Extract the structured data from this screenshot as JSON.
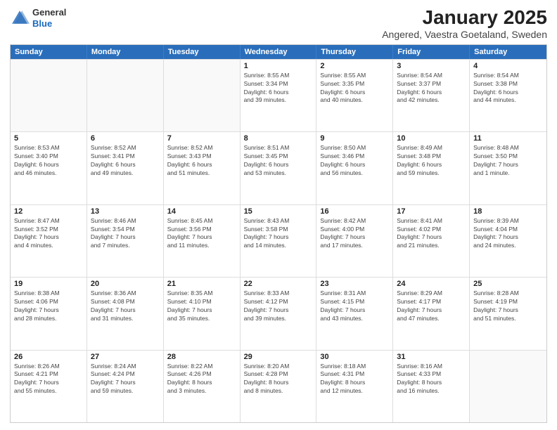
{
  "header": {
    "logo": {
      "general": "General",
      "blue": "Blue"
    },
    "title": "January 2025",
    "subtitle": "Angered, Vaestra Goetaland, Sweden"
  },
  "weekdays": [
    "Sunday",
    "Monday",
    "Tuesday",
    "Wednesday",
    "Thursday",
    "Friday",
    "Saturday"
  ],
  "rows": [
    [
      {
        "day": "",
        "info": "",
        "empty": true
      },
      {
        "day": "",
        "info": "",
        "empty": true
      },
      {
        "day": "",
        "info": "",
        "empty": true
      },
      {
        "day": "1",
        "info": "Sunrise: 8:55 AM\nSunset: 3:34 PM\nDaylight: 6 hours\nand 39 minutes."
      },
      {
        "day": "2",
        "info": "Sunrise: 8:55 AM\nSunset: 3:35 PM\nDaylight: 6 hours\nand 40 minutes."
      },
      {
        "day": "3",
        "info": "Sunrise: 8:54 AM\nSunset: 3:37 PM\nDaylight: 6 hours\nand 42 minutes."
      },
      {
        "day": "4",
        "info": "Sunrise: 8:54 AM\nSunset: 3:38 PM\nDaylight: 6 hours\nand 44 minutes."
      }
    ],
    [
      {
        "day": "5",
        "info": "Sunrise: 8:53 AM\nSunset: 3:40 PM\nDaylight: 6 hours\nand 46 minutes."
      },
      {
        "day": "6",
        "info": "Sunrise: 8:52 AM\nSunset: 3:41 PM\nDaylight: 6 hours\nand 49 minutes."
      },
      {
        "day": "7",
        "info": "Sunrise: 8:52 AM\nSunset: 3:43 PM\nDaylight: 6 hours\nand 51 minutes."
      },
      {
        "day": "8",
        "info": "Sunrise: 8:51 AM\nSunset: 3:45 PM\nDaylight: 6 hours\nand 53 minutes."
      },
      {
        "day": "9",
        "info": "Sunrise: 8:50 AM\nSunset: 3:46 PM\nDaylight: 6 hours\nand 56 minutes."
      },
      {
        "day": "10",
        "info": "Sunrise: 8:49 AM\nSunset: 3:48 PM\nDaylight: 6 hours\nand 59 minutes."
      },
      {
        "day": "11",
        "info": "Sunrise: 8:48 AM\nSunset: 3:50 PM\nDaylight: 7 hours\nand 1 minute."
      }
    ],
    [
      {
        "day": "12",
        "info": "Sunrise: 8:47 AM\nSunset: 3:52 PM\nDaylight: 7 hours\nand 4 minutes."
      },
      {
        "day": "13",
        "info": "Sunrise: 8:46 AM\nSunset: 3:54 PM\nDaylight: 7 hours\nand 7 minutes."
      },
      {
        "day": "14",
        "info": "Sunrise: 8:45 AM\nSunset: 3:56 PM\nDaylight: 7 hours\nand 11 minutes."
      },
      {
        "day": "15",
        "info": "Sunrise: 8:43 AM\nSunset: 3:58 PM\nDaylight: 7 hours\nand 14 minutes."
      },
      {
        "day": "16",
        "info": "Sunrise: 8:42 AM\nSunset: 4:00 PM\nDaylight: 7 hours\nand 17 minutes."
      },
      {
        "day": "17",
        "info": "Sunrise: 8:41 AM\nSunset: 4:02 PM\nDaylight: 7 hours\nand 21 minutes."
      },
      {
        "day": "18",
        "info": "Sunrise: 8:39 AM\nSunset: 4:04 PM\nDaylight: 7 hours\nand 24 minutes."
      }
    ],
    [
      {
        "day": "19",
        "info": "Sunrise: 8:38 AM\nSunset: 4:06 PM\nDaylight: 7 hours\nand 28 minutes."
      },
      {
        "day": "20",
        "info": "Sunrise: 8:36 AM\nSunset: 4:08 PM\nDaylight: 7 hours\nand 31 minutes."
      },
      {
        "day": "21",
        "info": "Sunrise: 8:35 AM\nSunset: 4:10 PM\nDaylight: 7 hours\nand 35 minutes."
      },
      {
        "day": "22",
        "info": "Sunrise: 8:33 AM\nSunset: 4:12 PM\nDaylight: 7 hours\nand 39 minutes."
      },
      {
        "day": "23",
        "info": "Sunrise: 8:31 AM\nSunset: 4:15 PM\nDaylight: 7 hours\nand 43 minutes."
      },
      {
        "day": "24",
        "info": "Sunrise: 8:29 AM\nSunset: 4:17 PM\nDaylight: 7 hours\nand 47 minutes."
      },
      {
        "day": "25",
        "info": "Sunrise: 8:28 AM\nSunset: 4:19 PM\nDaylight: 7 hours\nand 51 minutes."
      }
    ],
    [
      {
        "day": "26",
        "info": "Sunrise: 8:26 AM\nSunset: 4:21 PM\nDaylight: 7 hours\nand 55 minutes."
      },
      {
        "day": "27",
        "info": "Sunrise: 8:24 AM\nSunset: 4:24 PM\nDaylight: 7 hours\nand 59 minutes."
      },
      {
        "day": "28",
        "info": "Sunrise: 8:22 AM\nSunset: 4:26 PM\nDaylight: 8 hours\nand 3 minutes."
      },
      {
        "day": "29",
        "info": "Sunrise: 8:20 AM\nSunset: 4:28 PM\nDaylight: 8 hours\nand 8 minutes."
      },
      {
        "day": "30",
        "info": "Sunrise: 8:18 AM\nSunset: 4:31 PM\nDaylight: 8 hours\nand 12 minutes."
      },
      {
        "day": "31",
        "info": "Sunrise: 8:16 AM\nSunset: 4:33 PM\nDaylight: 8 hours\nand 16 minutes."
      },
      {
        "day": "",
        "info": "",
        "empty": true
      }
    ]
  ]
}
